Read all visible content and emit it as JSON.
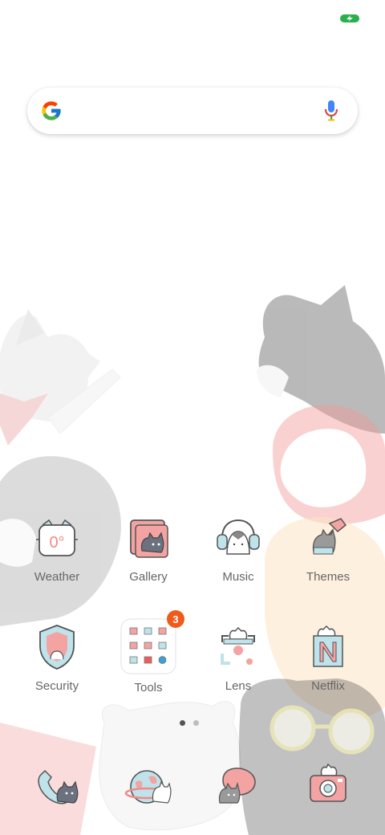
{
  "status_bar": {
    "battery_icon": "battery-charging-icon",
    "accent": "#2ab04a"
  },
  "search": {
    "logo": "google-g-icon",
    "mic_icon": "mic-icon",
    "placeholder": ""
  },
  "apps": [
    {
      "label": "Weather",
      "icon": "weather-cat-icon"
    },
    {
      "label": "Gallery",
      "icon": "gallery-cat-icon"
    },
    {
      "label": "Music",
      "icon": "music-cat-icon"
    },
    {
      "label": "Themes",
      "icon": "themes-cat-icon"
    },
    {
      "label": "Security",
      "icon": "security-shield-icon"
    },
    {
      "label": "Tools",
      "icon": "tools-folder-icon",
      "badge": "3"
    },
    {
      "label": "Lens",
      "icon": "lens-cat-icon"
    },
    {
      "label": "Netflix",
      "icon": "netflix-cat-icon"
    }
  ],
  "dock": [
    {
      "icon": "phone-cat-icon"
    },
    {
      "icon": "browser-globe-cat-icon"
    },
    {
      "icon": "messages-cat-icon"
    },
    {
      "icon": "camera-cat-icon"
    }
  ],
  "pages": {
    "count": 2,
    "active": 1
  },
  "colors": {
    "pink": "#f4a3a3",
    "light_blue": "#bfe3ea",
    "outline": "#555555",
    "badge": "#f05a1a"
  }
}
